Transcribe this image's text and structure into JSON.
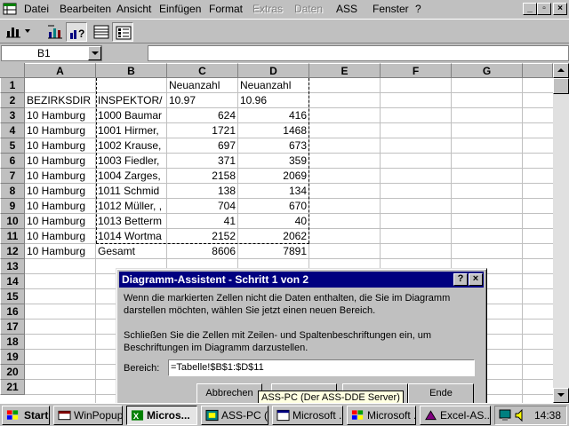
{
  "menubar": {
    "items": [
      {
        "label": "Datei",
        "enabled": true
      },
      {
        "label": "Bearbeiten",
        "enabled": true
      },
      {
        "label": "Ansicht",
        "enabled": true
      },
      {
        "label": "Einfügen",
        "enabled": true
      },
      {
        "label": "Format",
        "enabled": true
      },
      {
        "label": "Extras",
        "enabled": false
      },
      {
        "label": "Daten",
        "enabled": false
      },
      {
        "label": "ASS",
        "enabled": true
      },
      {
        "label": "Fenster",
        "enabled": true
      },
      {
        "label": "?",
        "enabled": true
      }
    ],
    "window_buttons": [
      "_",
      "▫",
      "×"
    ]
  },
  "namebox": {
    "value": "B1"
  },
  "formula": {
    "value": ""
  },
  "sheet": {
    "columns": [
      "A",
      "B",
      "C",
      "D",
      "E",
      "F",
      "G"
    ],
    "rows": [
      "1",
      "2",
      "3",
      "4",
      "5",
      "6",
      "7",
      "8",
      "9",
      "10",
      "11",
      "12",
      "13",
      "14",
      "15",
      "16",
      "17",
      "18",
      "19",
      "20",
      "21"
    ],
    "cells": [
      [
        "",
        "",
        "Neuanzahl",
        "Neuanzahl"
      ],
      [
        "BEZIRKSDIR",
        "INSPEKTOR/",
        "10.97",
        "10.96"
      ],
      [
        "10 Hamburg",
        "1000 Baumar",
        "624",
        "416"
      ],
      [
        "10 Hamburg",
        "1001 Hirmer,",
        "1721",
        "1468"
      ],
      [
        "10 Hamburg",
        "1002 Krause,",
        "697",
        "673"
      ],
      [
        "10 Hamburg",
        "1003 Fiedler,",
        "371",
        "359"
      ],
      [
        "10 Hamburg",
        "1004 Zarges,",
        "2158",
        "2069"
      ],
      [
        "10 Hamburg",
        "1011 Schmid",
        "138",
        "134"
      ],
      [
        "10 Hamburg",
        "1012 Müller, ,",
        "704",
        "670"
      ],
      [
        "10 Hamburg",
        "1013 Betterm",
        "41",
        "40"
      ],
      [
        "10 Hamburg",
        "1014 Wortma",
        "2152",
        "2062"
      ],
      [
        "10 Hamburg",
        "Gesamt",
        "8606",
        "7891"
      ]
    ]
  },
  "dialog": {
    "title": "Diagramm-Assistent - Schritt 1 von 2",
    "text1": "Wenn die markierten Zellen nicht die Daten enthalten, die Sie im Diagramm darstellen möchten, wählen Sie jetzt einen neuen Bereich.",
    "text2": "Schließen Sie die Zellen mit Zeilen- und Spaltenbeschriftungen ein, um Beschriftungen im Diagramm darzustellen.",
    "range_label": "Bereich:",
    "range_value": "=Tabelle!$B$1:$D$11",
    "buttons": {
      "cancel": "Abbrechen",
      "finish": "Ende"
    },
    "help_btn": "?",
    "close_btn": "×"
  },
  "tooltip": "ASS-PC (Der ASS-DDE Server)",
  "taskbar": {
    "start": "Start",
    "tasks": [
      {
        "label": "WinPopup",
        "active": false
      },
      {
        "label": "Micros...",
        "active": true
      },
      {
        "label": "ASS-PC (...",
        "active": false
      },
      {
        "label": "Microsoft ...",
        "active": false
      },
      {
        "label": "Microsoft ...",
        "active": false
      },
      {
        "label": "Excel-AS...",
        "active": false
      }
    ],
    "clock": "14:38"
  },
  "colors": {
    "titlebar": "#000080",
    "face": "#c0c0c0",
    "tooltip_bg": "#ffffe1"
  }
}
